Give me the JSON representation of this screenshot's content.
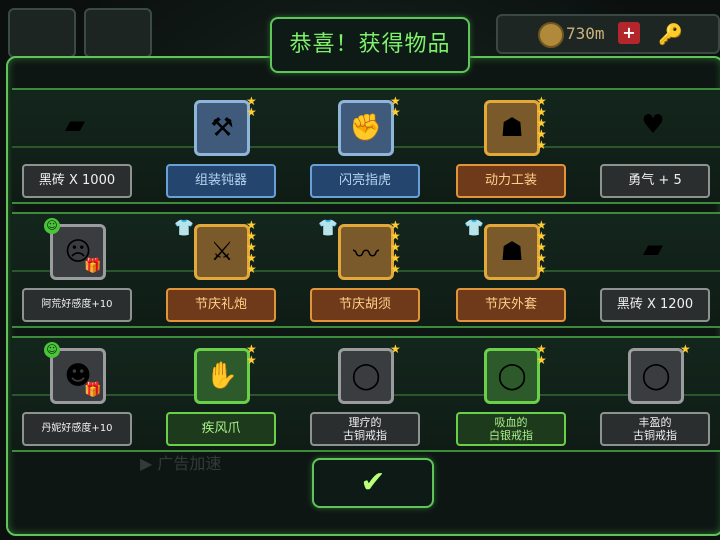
{
  "topbar": {
    "amount": "730m",
    "plus": "+",
    "key": "🔑",
    "coin": "⏱"
  },
  "dialog": {
    "title": "恭喜！获得物品",
    "confirm": "✔",
    "ad_text": "▶ 广告加速"
  },
  "rows": [
    {
      "items": [
        {
          "label": "黑砖 X 1000",
          "icon": "▰",
          "frame": "plain",
          "label_style": "",
          "stars": 0
        },
        {
          "label": "组装钝器",
          "icon": "⚒",
          "frame": "blue",
          "label_style": "blue",
          "stars": 2
        },
        {
          "label": "闪亮指虎",
          "icon": "✊",
          "frame": "blue",
          "label_style": "blue",
          "stars": 2
        },
        {
          "label": "动力工装",
          "icon": "☗",
          "frame": "orange",
          "label_style": "orange",
          "stars": 5
        },
        {
          "label": "勇气 + 5",
          "icon": "♥",
          "frame": "plain",
          "label_style": "",
          "stars": 0
        }
      ]
    },
    {
      "items": [
        {
          "label": "阿荒好感度+10",
          "icon": "☹",
          "frame": "grey",
          "label_style": "small",
          "stars": 0,
          "badge": "☺",
          "gift": "🎁"
        },
        {
          "label": "节庆礼炮",
          "icon": "⚔",
          "frame": "orange",
          "label_style": "orange",
          "stars": 5,
          "shirt": "👕"
        },
        {
          "label": "节庆胡须",
          "icon": "〰",
          "frame": "orange",
          "label_style": "orange",
          "stars": 5,
          "shirt": "👕"
        },
        {
          "label": "节庆外套",
          "icon": "☗",
          "frame": "orange",
          "label_style": "orange",
          "stars": 5,
          "shirt": "👕"
        },
        {
          "label": "黑砖 X 1200",
          "icon": "▰",
          "frame": "plain",
          "label_style": "",
          "stars": 0
        }
      ]
    },
    {
      "items": [
        {
          "label": "丹妮好感度+10",
          "icon": "☻",
          "frame": "grey",
          "label_style": "small",
          "stars": 0,
          "badge": "☺",
          "gift": "🎁"
        },
        {
          "label": "疾风爪",
          "icon": "✋",
          "frame": "green",
          "label_style": "green",
          "stars": 2
        },
        {
          "label": "理疗的\n古铜戒指",
          "icon": "◯",
          "frame": "grey",
          "label_style": "two",
          "stars": 1
        },
        {
          "label": "吸血的\n白银戒指",
          "icon": "◯",
          "frame": "green",
          "label_style": "green two",
          "stars": 2
        },
        {
          "label": "丰盈的\n古铜戒指",
          "icon": "◯",
          "frame": "grey",
          "label_style": "two",
          "stars": 1
        }
      ]
    }
  ]
}
